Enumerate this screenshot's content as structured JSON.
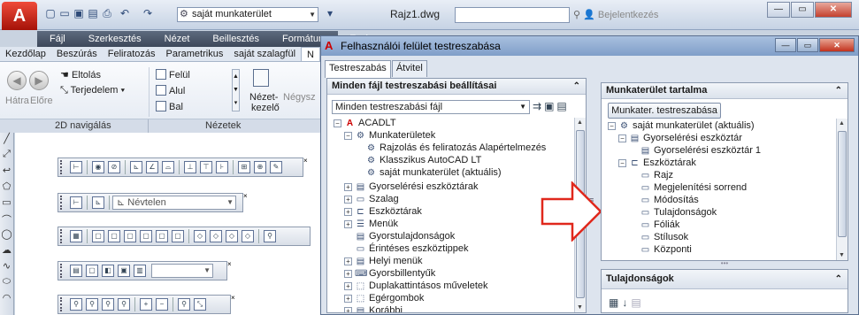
{
  "titlebar": {
    "app_letter": "A",
    "workspace": "saját munkaterület",
    "doc_title": "Rajz1.dwg",
    "login": "Bejelentkezés"
  },
  "menubar": {
    "items": [
      "Fájl",
      "Szerkesztés",
      "Nézet",
      "Beillesztés",
      "Formátum",
      "Eszk"
    ]
  },
  "ribbon": {
    "tabs": [
      "Kezdőlap",
      "Beszúrás",
      "Feliratozás",
      "Parametrikus",
      "saját szalagfül",
      "N"
    ],
    "nav_back": "Hátra",
    "nav_forward": "Előre",
    "pan": "Eltolás",
    "extents": "Terjedelem",
    "view_top": "Felül",
    "view_bottom": "Alul",
    "view_left": "Bal",
    "view_manager_1": "Nézet-",
    "view_manager_2": "kezelő",
    "quad": "Négysz",
    "panel_nav": "2D navigálás",
    "panel_views": "Nézetek"
  },
  "drawing": {
    "toolbar_combo": "Névtelen"
  },
  "dialog": {
    "title": "Felhasználói felület testreszabása",
    "tabs": [
      "Testreszabás",
      "Átvitel"
    ],
    "left_panel": {
      "header": "Minden fájl testreszabási beállításai",
      "filter": "Minden testreszabási fájl",
      "tree": [
        "ACADLT",
        "Munkaterületek",
        "Rajzolás és feliratozás Alapértelmezés",
        "Klasszikus AutoCAD LT",
        "saját munkaterület (aktuális)",
        "Gyorselérési eszköztárak",
        "Szalag",
        "Eszköztárak",
        "Menük",
        "Gyorstulajdonságok",
        "Érintéses eszköztippek",
        "Helyi menük",
        "Gyorsbillentyűk",
        "Duplakattintásos műveletek",
        "Egérgombok",
        "Korábbi"
      ]
    },
    "right_panel": {
      "header": "Munkaterület tartalma",
      "button": "Munkater. testreszabása",
      "tree": [
        "saját munkaterület (aktuális)",
        "Gyorselérési eszköztár",
        "Gyorselérési eszköztár 1",
        "Eszköztárak",
        "Rajz",
        "Megjelenítési sorrend",
        "Módosítás",
        "Tulajdonságok",
        "Fóliák",
        "Stílusok",
        "Központi"
      ]
    },
    "props_panel": {
      "header": "Tulajdonságok"
    }
  }
}
